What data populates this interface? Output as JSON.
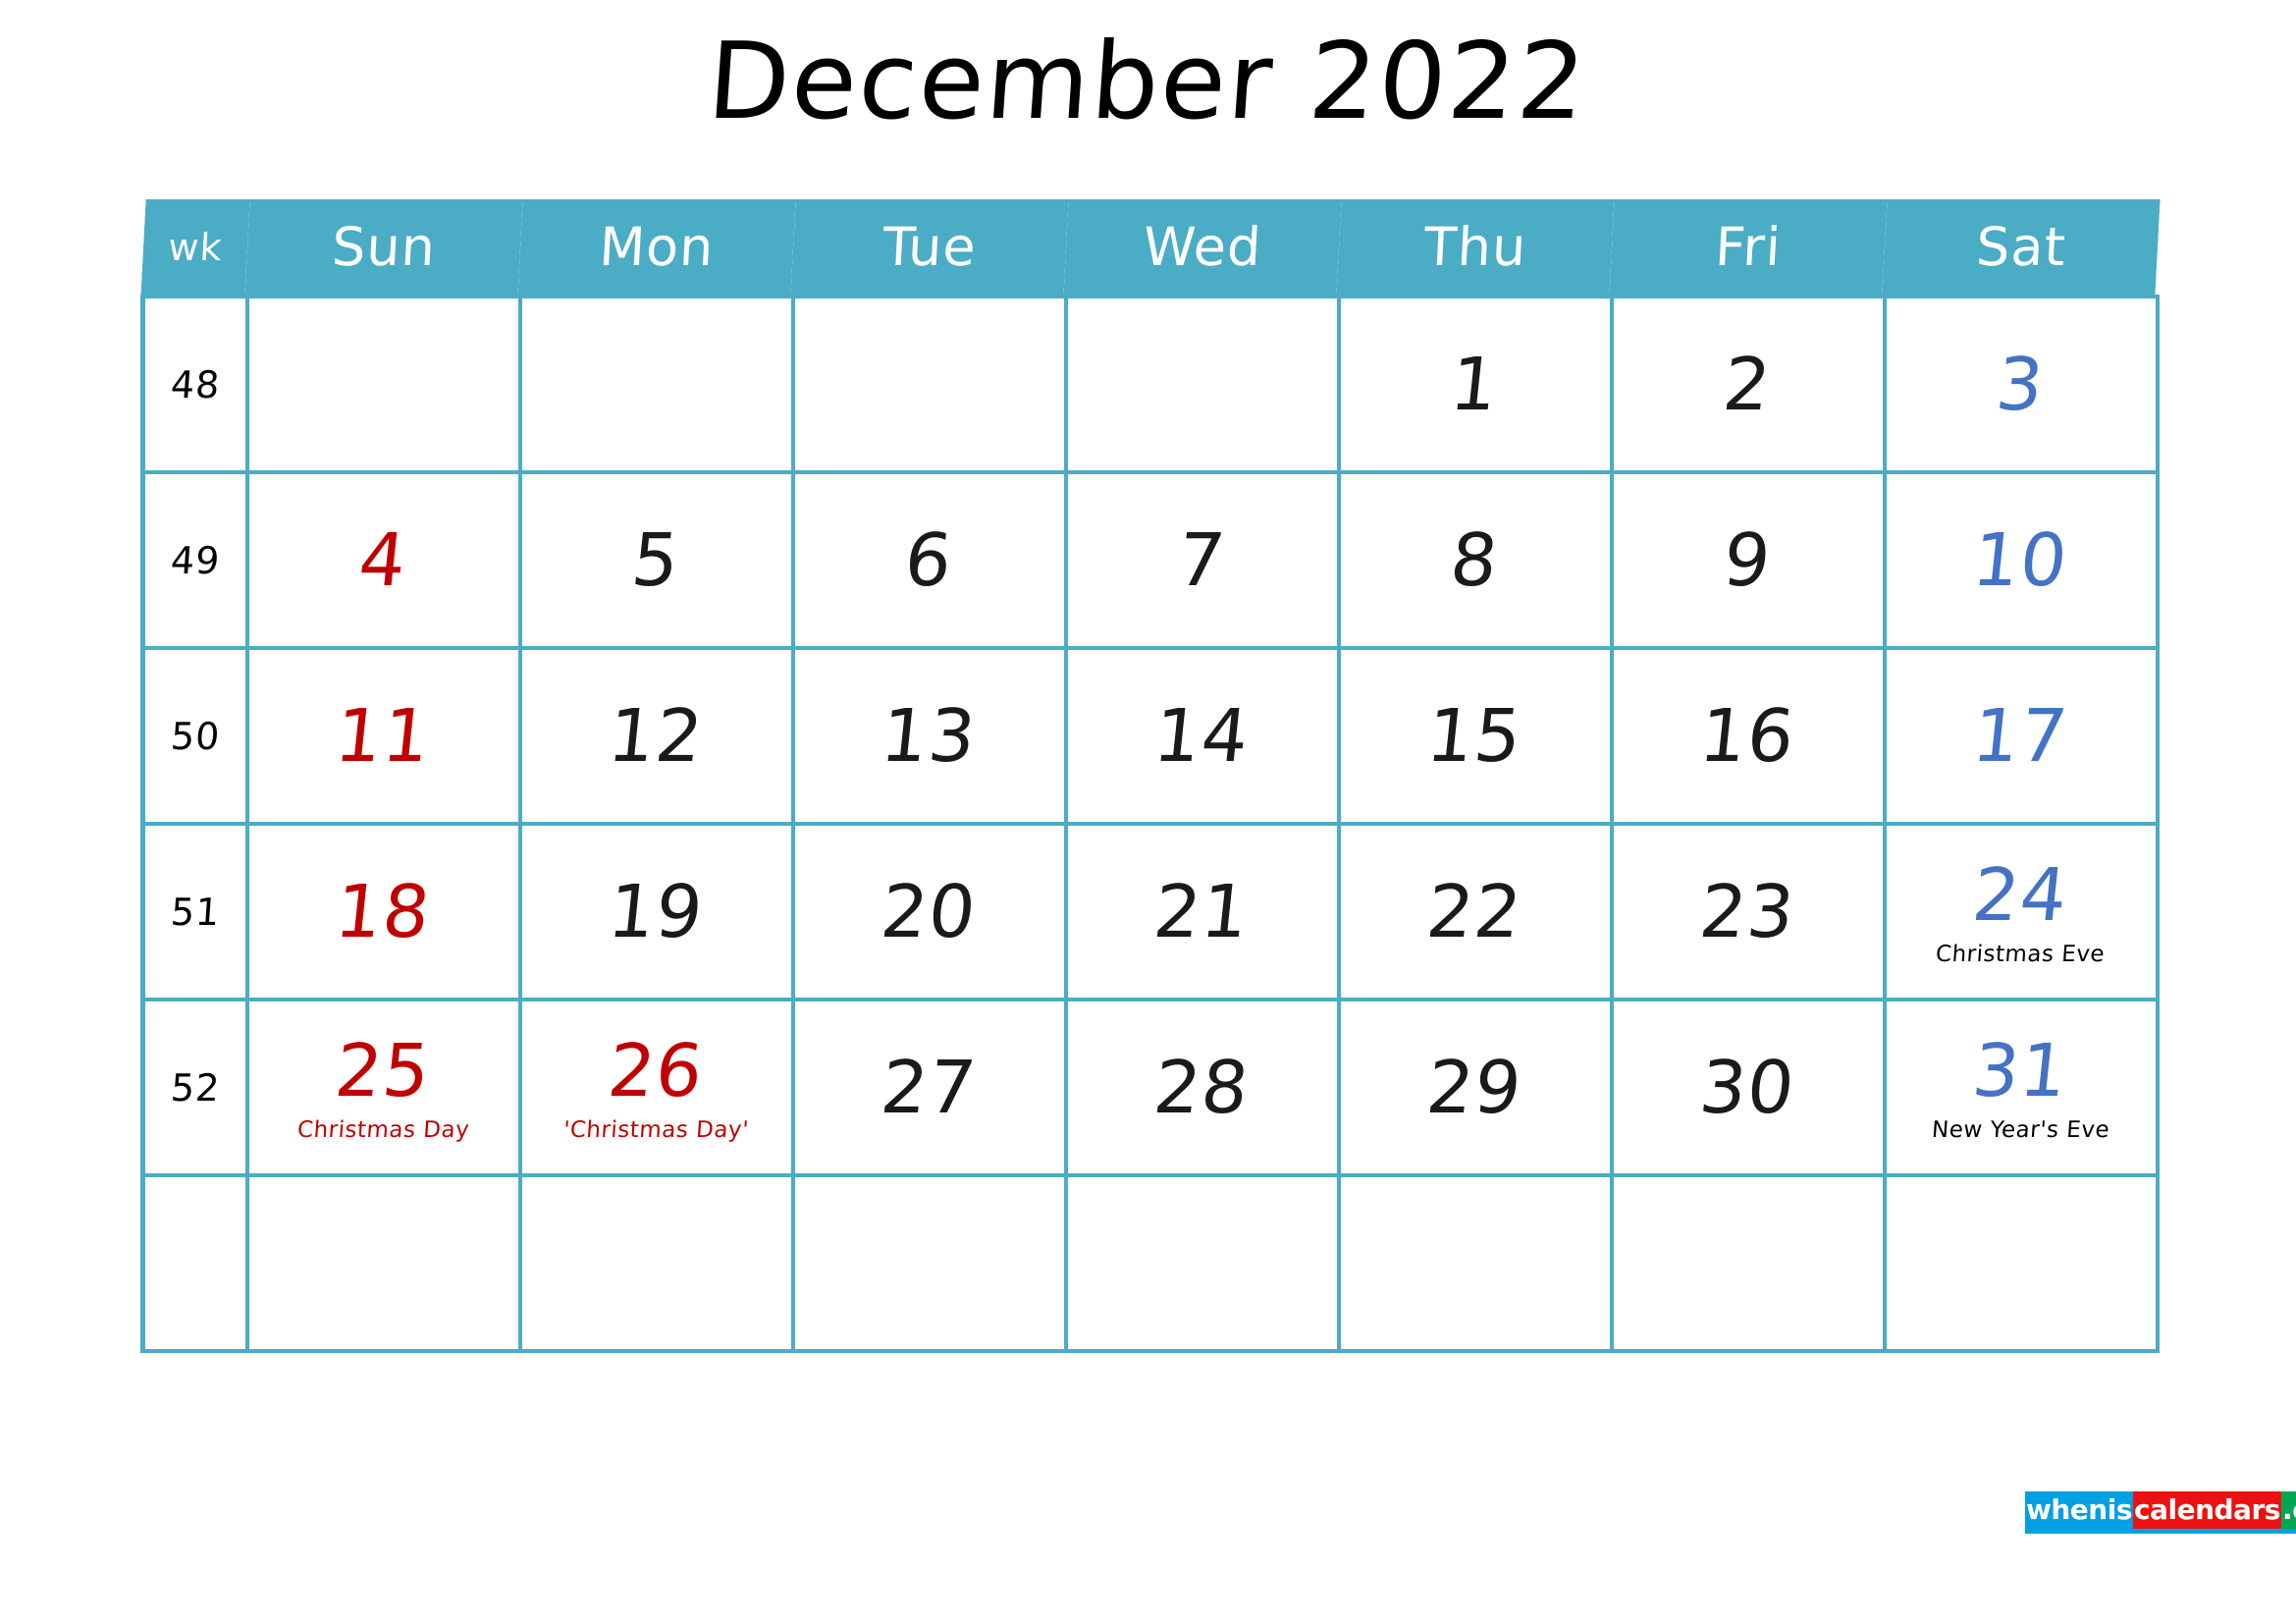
{
  "title": "December 2022",
  "colors": {
    "header_bg": "#4BACC6",
    "grid_line": "#4BACC6",
    "sunday": "#C00000",
    "saturday": "#4472C4",
    "weekday": "#1a1a1a",
    "logo_blue": "#00A0E3",
    "logo_red": "#EE1111",
    "logo_green": "#00A651"
  },
  "headers": {
    "week": "wk",
    "days": [
      "Sun",
      "Mon",
      "Tue",
      "Wed",
      "Thu",
      "Fri",
      "Sat"
    ]
  },
  "weeks": [
    {
      "wk": "48",
      "days": [
        {
          "num": "",
          "note": ""
        },
        {
          "num": "",
          "note": ""
        },
        {
          "num": "",
          "note": ""
        },
        {
          "num": "",
          "note": ""
        },
        {
          "num": "1",
          "note": ""
        },
        {
          "num": "2",
          "note": ""
        },
        {
          "num": "3",
          "note": ""
        }
      ]
    },
    {
      "wk": "49",
      "days": [
        {
          "num": "4",
          "note": ""
        },
        {
          "num": "5",
          "note": ""
        },
        {
          "num": "6",
          "note": ""
        },
        {
          "num": "7",
          "note": ""
        },
        {
          "num": "8",
          "note": ""
        },
        {
          "num": "9",
          "note": ""
        },
        {
          "num": "10",
          "note": ""
        }
      ]
    },
    {
      "wk": "50",
      "days": [
        {
          "num": "11",
          "note": ""
        },
        {
          "num": "12",
          "note": ""
        },
        {
          "num": "13",
          "note": ""
        },
        {
          "num": "14",
          "note": ""
        },
        {
          "num": "15",
          "note": ""
        },
        {
          "num": "16",
          "note": ""
        },
        {
          "num": "17",
          "note": ""
        }
      ]
    },
    {
      "wk": "51",
      "days": [
        {
          "num": "18",
          "note": ""
        },
        {
          "num": "19",
          "note": ""
        },
        {
          "num": "20",
          "note": ""
        },
        {
          "num": "21",
          "note": ""
        },
        {
          "num": "22",
          "note": ""
        },
        {
          "num": "23",
          "note": ""
        },
        {
          "num": "24",
          "note": "Christmas Eve"
        }
      ]
    },
    {
      "wk": "52",
      "days": [
        {
          "num": "25",
          "note": "Christmas Day"
        },
        {
          "num": "26",
          "note": "'Christmas Day'"
        },
        {
          "num": "27",
          "note": ""
        },
        {
          "num": "28",
          "note": ""
        },
        {
          "num": "29",
          "note": ""
        },
        {
          "num": "30",
          "note": ""
        },
        {
          "num": "31",
          "note": "New Year's Eve"
        }
      ]
    },
    {
      "wk": "",
      "days": [
        {
          "num": "",
          "note": ""
        },
        {
          "num": "",
          "note": ""
        },
        {
          "num": "",
          "note": ""
        },
        {
          "num": "",
          "note": ""
        },
        {
          "num": "",
          "note": ""
        },
        {
          "num": "",
          "note": ""
        },
        {
          "num": "",
          "note": ""
        }
      ]
    }
  ],
  "logo": {
    "part1": "whenis",
    "part2": "calendars",
    "part3": ".com"
  }
}
